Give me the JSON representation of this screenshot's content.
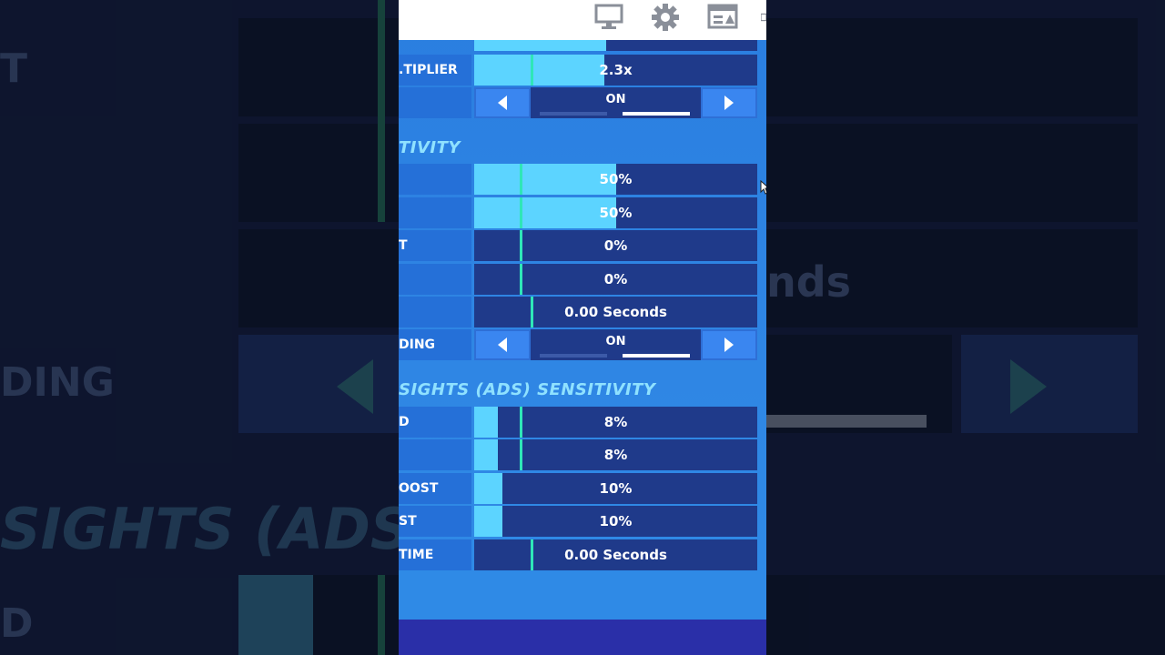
{
  "background": {
    "label_top_left": "T",
    "label_seconds": "nds",
    "label_ding": "DING",
    "label_ads": "SIGHTS (ADS) S",
    "label_d": "D"
  },
  "topbar": {
    "icons": [
      "monitor-icon",
      "gear-icon",
      "hud-layout-icon",
      "partial-icon"
    ]
  },
  "rows_top": [
    {
      "label": ".TIPLIER",
      "value": "2.3x",
      "fill": 0.46,
      "mark": 0.2
    },
    {
      "label": "",
      "type": "toggle",
      "value": "ON"
    }
  ],
  "section_sensitivity": {
    "title": "TIVITY",
    "rows": [
      {
        "label": "",
        "value": "50%",
        "fill": 0.5,
        "mark": 0.16
      },
      {
        "label": "",
        "value": "50%",
        "fill": 0.5,
        "mark": 0.16
      },
      {
        "label": "T",
        "value": "0%",
        "fill": 0.0,
        "mark": 0.16
      },
      {
        "label": "",
        "value": "0%",
        "fill": 0.0,
        "mark": 0.16
      },
      {
        "label": "",
        "value": "0.00 Seconds",
        "fill": 0.0,
        "mark": 0.2
      }
    ],
    "toggle": {
      "label": "DING",
      "value": "ON"
    }
  },
  "section_ads": {
    "title": "SIGHTS (ADS) SENSITIVITY",
    "rows": [
      {
        "label": "D",
        "value": "8%",
        "fill": 0.08,
        "mark": 0.16
      },
      {
        "label": "",
        "value": "8%",
        "fill": 0.08,
        "mark": 0.16
      },
      {
        "label": "OOST",
        "value": "10%",
        "fill": 0.1,
        "mark": null
      },
      {
        "label": "ST",
        "value": "10%",
        "fill": 0.1,
        "mark": null
      },
      {
        "label": "TIME",
        "value": "0.00 Seconds",
        "fill": 0.0,
        "mark": 0.2
      }
    ]
  },
  "colors": {
    "fill": "#5cd4ff",
    "track": "#1f3a8a",
    "marker": "#2fe6b8",
    "section_title": "#8fe1ff"
  }
}
